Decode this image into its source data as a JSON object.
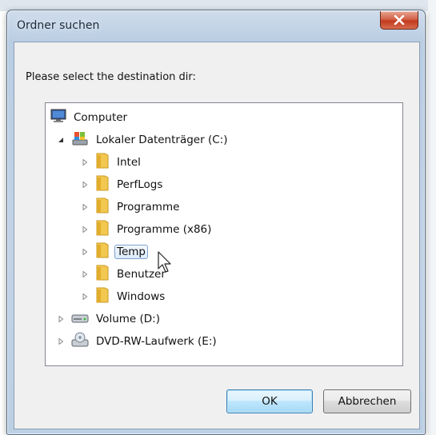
{
  "dialog": {
    "title": "Ordner suchen",
    "prompt": "Please select the destination dir:"
  },
  "tree": {
    "computer": "Computer",
    "drive_c": "Lokaler Datenträger (C:)",
    "folders": [
      "Intel",
      "PerfLogs",
      "Programme",
      "Programme (x86)",
      "Temp",
      "Benutzer",
      "Windows"
    ],
    "selected_folder": "Temp",
    "drive_d": "Volume (D:)",
    "drive_e": "DVD-RW-Laufwerk (E:)"
  },
  "buttons": {
    "ok": "OK",
    "cancel": "Abbrechen"
  },
  "colors": {
    "folder": "#f3c850",
    "selection_border": "#7da2ce",
    "close_button": "#c23b1f"
  }
}
